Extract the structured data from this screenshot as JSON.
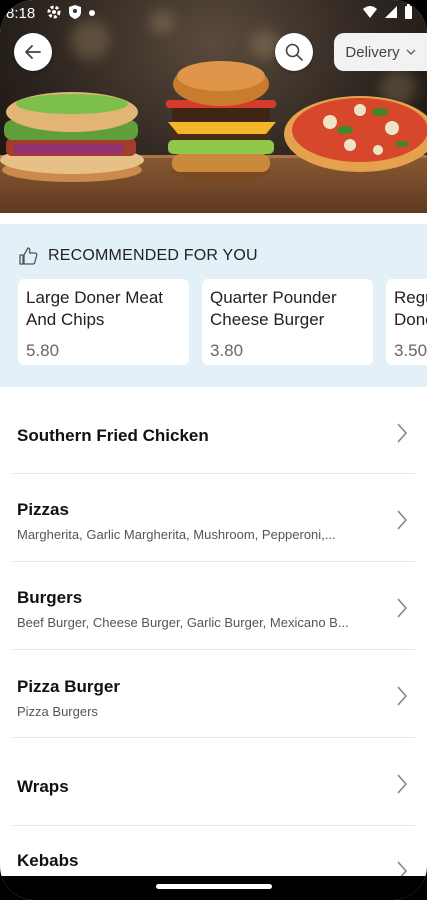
{
  "status_bar": {
    "time": "8:18",
    "left_icons": [
      "gear-icon",
      "shield-icon",
      "notification-dot-icon"
    ],
    "right_icons": [
      "wifi-icon",
      "signal-icon",
      "battery-icon"
    ]
  },
  "header": {
    "back_icon": "arrow-left-icon",
    "search_icon": "search-icon",
    "delivery_label": "Delivery",
    "delivery_icon": "chevron-down-icon"
  },
  "recommended": {
    "heading": "RECOMMENDED FOR YOU",
    "icon": "thumbs-up-icon",
    "items": [
      {
        "name": "Large Doner Meat\nAnd Chips",
        "price": "5.80"
      },
      {
        "name": "Quarter Pounder\nCheese Burger",
        "price": "3.80"
      },
      {
        "name": "Regu\nDone",
        "price": "3.50"
      }
    ]
  },
  "categories": [
    {
      "title": "Southern Fried Chicken",
      "subtitle": ""
    },
    {
      "title": "Pizzas",
      "subtitle": "Margherita, Garlic Margherita, Mushroom, Pepperoni,..."
    },
    {
      "title": "Burgers",
      "subtitle": "Beef Burger, Cheese Burger, Garlic Burger, Mexicano B..."
    },
    {
      "title": "Pizza Burger",
      "subtitle": "Pizza Burgers"
    },
    {
      "title": "Wraps",
      "subtitle": ""
    },
    {
      "title": "Kebabs",
      "subtitle": ""
    }
  ],
  "colors": {
    "recommended_bg": "#e4f0f7",
    "divider": "#e8e8e8"
  }
}
